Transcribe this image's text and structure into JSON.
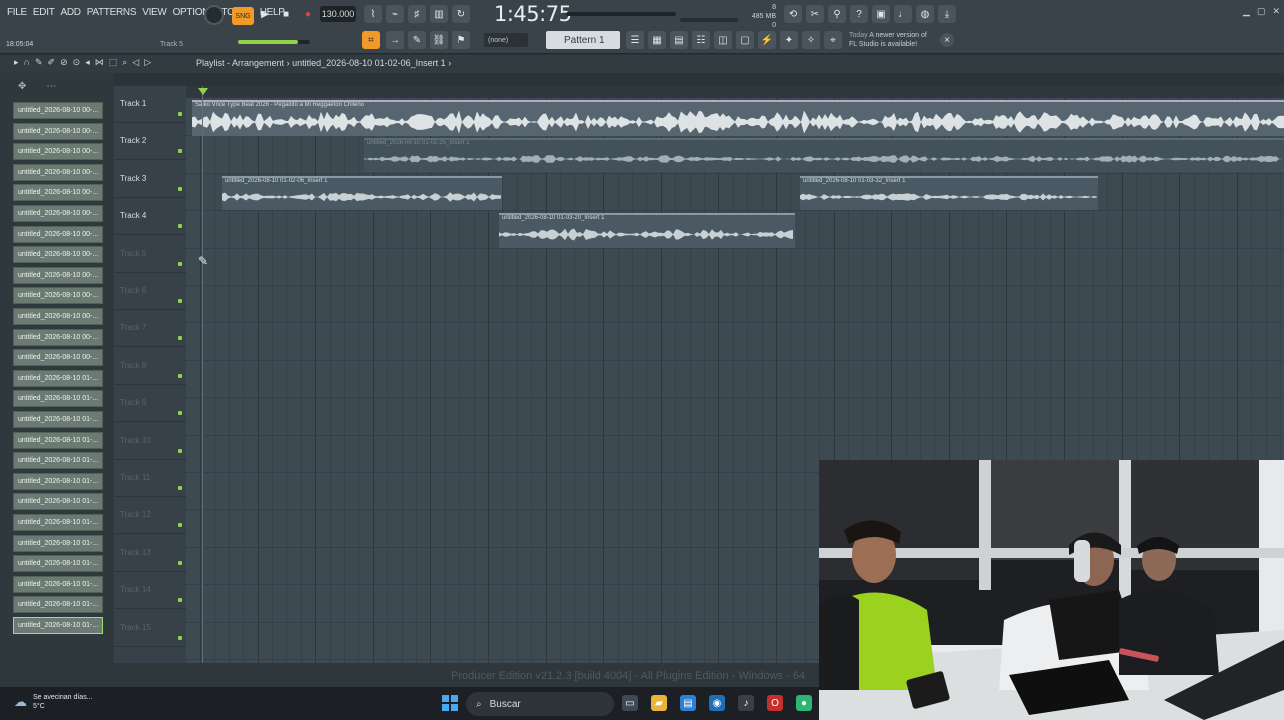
{
  "menu": [
    "FILE",
    "EDIT",
    "ADD",
    "PATTERNS",
    "VIEW",
    "OPTIONS",
    "TOOLS",
    "HELP"
  ],
  "hint": {
    "time": "18:05:04",
    "track": "Track 5"
  },
  "transport": {
    "tempo": "130.000",
    "clock": "1:45:75",
    "cpu_line1": "8",
    "cpu_line2": "485 MB",
    "cpu_line3": "0"
  },
  "toolbar": {
    "pattern_selector": "(none)",
    "pattern_name": "Pattern 1"
  },
  "news": {
    "today": "Today",
    "message_line1": "A newer version of",
    "message_line2": "FL Studio is available!"
  },
  "playlist": {
    "title": "Playlist - Arrangement",
    "separator": "›",
    "current_clip": "untitled_2026-08-10 01-02-06_Insert 1",
    "trail": "›"
  },
  "browser_items": [
    "untitled_2026-08-10 00-...",
    "untitled_2026-08-10 00-...",
    "untitled_2026-08-10 00-...",
    "untitled_2026-08-10 00-...",
    "untitled_2026-08-10 00-...",
    "untitled_2026-08-10 00-...",
    "untitled_2026-08-10 00-...",
    "untitled_2026-08-10 00-...",
    "untitled_2026-08-10 00-...",
    "untitled_2026-08-10 00-...",
    "untitled_2026-08-10 00-...",
    "untitled_2026-08-10 00-...",
    "untitled_2026-08-10 00-...",
    "untitled_2026-08-10 01-...",
    "untitled_2026-08-10 01-...",
    "untitled_2026-08-10 01-...",
    "untitled_2026-08-10 01-...",
    "untitled_2026-08-10 01-...",
    "untitled_2026-08-10 01-...",
    "untitled_2026-08-10 01-...",
    "untitled_2026-08-10 01-...",
    "untitled_2026-08-10 01-...",
    "untitled_2026-08-10 01-...",
    "untitled_2026-08-10 01-...",
    "untitled_2026-08-10 01-...",
    "untitled_2026-08-10 01-..."
  ],
  "tracks": [
    "Track 1",
    "Track 2",
    "Track 3",
    "Track 4",
    "Track 5",
    "Track 6",
    "Track 7",
    "Track 8",
    "Track 9",
    "Track 10",
    "Track 11",
    "Track 12",
    "Track 13",
    "Track 14",
    "Track 15"
  ],
  "clips": {
    "main": "Saiko Vnce Type Beat 2026 - Pegadito a Mi  Reggaeton Chileno",
    "track2": "untitled_2026-08-10 01-02-25_Insert 1",
    "track3a": "untitled_2026-08-10 01-02-06_Insert 1",
    "track3b": "untitled_2026-08-10 01-03-32_Insert 1",
    "track4": "untitled_2026-08-10 01-03-20_Insert 1"
  },
  "status": {
    "edition": "Producer Edition v21.2.3 [build 4004] - All Plugins Edition - Windows - 64"
  },
  "taskbar": {
    "weather_line1": "Se avecinan días...",
    "weather_line2": "5°C",
    "search": "Buscar"
  },
  "colors": {
    "accent_green": "#8fd34a",
    "record_orange": "#f29a28",
    "clip_bg": "#56656f"
  }
}
